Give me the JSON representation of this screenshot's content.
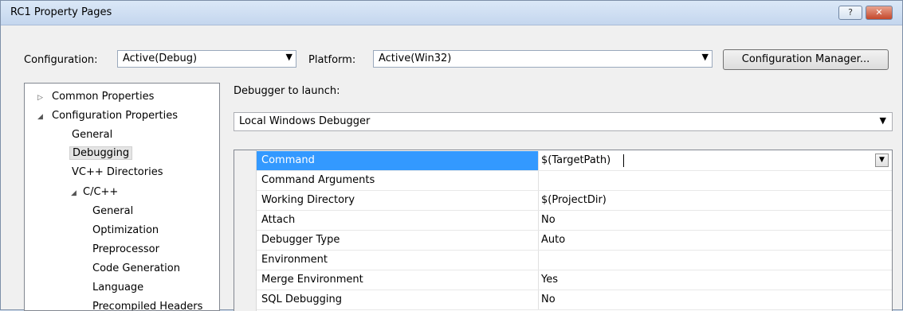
{
  "window": {
    "title": "RC1 Property Pages",
    "help_glyph": "?",
    "close_glyph": "✕"
  },
  "toolbar": {
    "configuration_label": "Configuration:",
    "configuration_value": "Active(Debug)",
    "platform_label": "Platform:",
    "platform_value": "Active(Win32)",
    "config_manager_label": "Configuration Manager..."
  },
  "tree": {
    "items": [
      {
        "label": "Common Properties",
        "expander": "▷"
      },
      {
        "label": "Configuration Properties",
        "expander": "◢"
      },
      {
        "label": "General"
      },
      {
        "label": "Debugging"
      },
      {
        "label": "VC++ Directories"
      },
      {
        "label": "C/C++",
        "expander": "◢"
      },
      {
        "label": "General"
      },
      {
        "label": "Optimization"
      },
      {
        "label": "Preprocessor"
      },
      {
        "label": "Code Generation"
      },
      {
        "label": "Language"
      },
      {
        "label": "Precompiled Headers"
      }
    ]
  },
  "debugger": {
    "launch_label": "Debugger to launch:",
    "launch_value": "Local Windows Debugger"
  },
  "grid": {
    "rows": [
      {
        "name": "Command",
        "value": "$(TargetPath)"
      },
      {
        "name": "Command Arguments",
        "value": ""
      },
      {
        "name": "Working Directory",
        "value": "$(ProjectDir)"
      },
      {
        "name": "Attach",
        "value": "No"
      },
      {
        "name": "Debugger Type",
        "value": "Auto"
      },
      {
        "name": "Environment",
        "value": ""
      },
      {
        "name": "Merge Environment",
        "value": "Yes"
      },
      {
        "name": "SQL Debugging",
        "value": "No"
      }
    ]
  },
  "icons": {
    "dropdown": "▼"
  }
}
